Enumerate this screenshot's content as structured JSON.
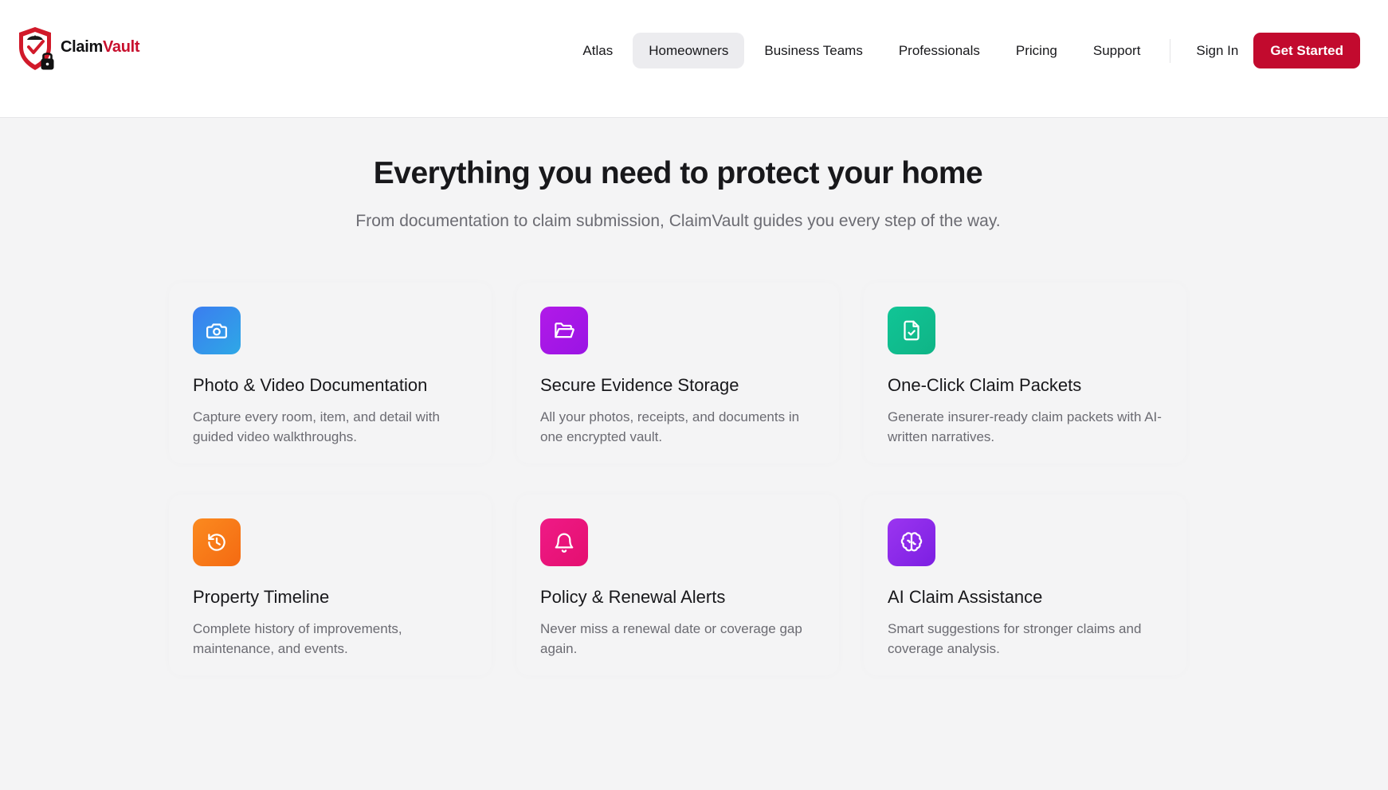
{
  "brand": {
    "name_part1": "Claim",
    "name_part2": "Vault",
    "colors": {
      "primary": "#c20a2e",
      "text": "#18181b",
      "muted": "#6b6b72"
    }
  },
  "nav": {
    "items": [
      {
        "label": "Atlas",
        "active": false
      },
      {
        "label": "Homeowners",
        "active": true
      },
      {
        "label": "Business Teams",
        "active": false
      },
      {
        "label": "Professionals",
        "active": false
      },
      {
        "label": "Pricing",
        "active": false
      },
      {
        "label": "Support",
        "active": false
      }
    ],
    "sign_in": "Sign In",
    "cta": "Get Started"
  },
  "hero": {
    "title": "Everything you need to protect your home",
    "subtitle": "From documentation to claim submission, ClaimVault guides you every step of the way."
  },
  "features": [
    {
      "icon": "camera-icon",
      "color": "#3b7df0",
      "title": "Photo & Video Documentation",
      "description": "Capture every room, item, and detail with guided video walkthroughs."
    },
    {
      "icon": "folder-open-icon",
      "color": "#b11ae8",
      "title": "Secure Evidence Storage",
      "description": "All your photos, receipts, and documents in one encrypted vault."
    },
    {
      "icon": "file-check-icon",
      "color": "#11c596",
      "title": "One-Click Claim Packets",
      "description": "Generate insurer-ready claim packets with AI-written narratives."
    },
    {
      "icon": "history-icon",
      "color": "#fb8a1f",
      "title": "Property Timeline",
      "description": "Complete history of improvements, maintenance, and events."
    },
    {
      "icon": "bell-icon",
      "color": "#ef1a86",
      "title": "Policy & Renewal Alerts",
      "description": "Never miss a renewal date or coverage gap again."
    },
    {
      "icon": "brain-icon",
      "color": "#9b35f0",
      "title": "AI Claim Assistance",
      "description": "Smart suggestions for stronger claims and coverage analysis."
    }
  ]
}
